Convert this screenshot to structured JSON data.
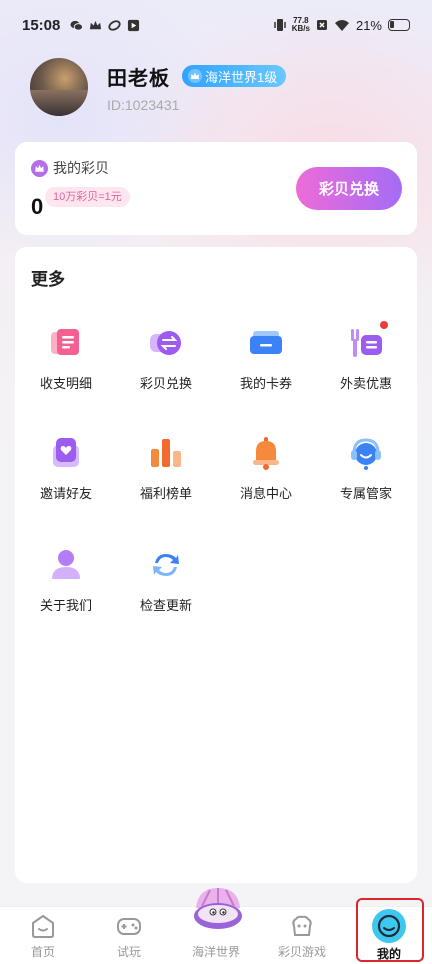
{
  "status_bar": {
    "time": "15:08",
    "net_speed_value": "77.8",
    "net_speed_unit": "KB/s",
    "battery": "21%"
  },
  "profile": {
    "name": "田老板",
    "level": "海洋世界1级",
    "id": "ID:1023431"
  },
  "points": {
    "title": "我的彩贝",
    "value": "0",
    "rate": "10万彩贝=1元",
    "exchange_label": "彩贝兑换"
  },
  "more": {
    "title": "更多",
    "items": [
      {
        "label": "收支明细",
        "icon": "ledger-icon"
      },
      {
        "label": "彩贝兑换",
        "icon": "exchange-icon"
      },
      {
        "label": "我的卡券",
        "icon": "coupon-icon"
      },
      {
        "label": "外卖优惠",
        "icon": "food-discount-icon",
        "badge_dot": true
      },
      {
        "label": "邀请好友",
        "icon": "invite-icon"
      },
      {
        "label": "福利榜单",
        "icon": "ranking-icon"
      },
      {
        "label": "消息中心",
        "icon": "bell-icon"
      },
      {
        "label": "专属管家",
        "icon": "headset-icon"
      },
      {
        "label": "关于我们",
        "icon": "person-icon"
      },
      {
        "label": "检查更新",
        "icon": "refresh-icon"
      }
    ]
  },
  "tabs": [
    {
      "label": "首页",
      "icon": "home-icon"
    },
    {
      "label": "试玩",
      "icon": "gamepad-icon"
    },
    {
      "label": "海洋世界",
      "icon": "shell-icon"
    },
    {
      "label": "彩贝游戏",
      "icon": "game-icon"
    },
    {
      "label": "我的",
      "icon": "profile-icon",
      "active": true
    }
  ],
  "colors": {
    "accent_pink": "#ee6bd8",
    "accent_purple": "#a46cf5",
    "level_blue": "#2fa3ff",
    "active_tab": "#3ec7ef",
    "highlight_red": "#d8282c"
  }
}
